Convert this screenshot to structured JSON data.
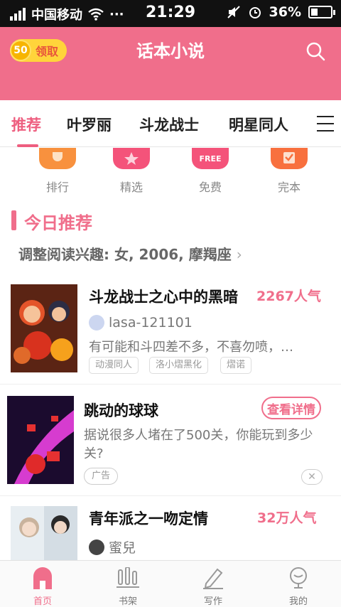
{
  "status_bar": {
    "carrier": "中国移动",
    "time": "21:29",
    "battery": "36%",
    "battery_level": 0.36
  },
  "header": {
    "coin_count": "50",
    "coin_action": "领取",
    "title": "话本小说"
  },
  "tabs": [
    {
      "label": "推荐",
      "active": true
    },
    {
      "label": "叶罗丽",
      "active": false
    },
    {
      "label": "斗龙战士",
      "active": false
    },
    {
      "label": "明星同人",
      "active": false
    }
  ],
  "categories": [
    {
      "label": "排行",
      "icon": "trophy-icon",
      "color": "#f8913e"
    },
    {
      "label": "精选",
      "icon": "star-icon",
      "color": "#f4537a"
    },
    {
      "label": "免费",
      "icon": "free-icon",
      "icon_text": "FREE",
      "color": "#f4537a"
    },
    {
      "label": "完本",
      "icon": "check-icon",
      "color": "#f8703e"
    }
  ],
  "today": {
    "title": "今日推荐",
    "interest": "调整阅读兴趣: 女, 2006, 摩羯座",
    "interest_chevron": "›"
  },
  "books": [
    {
      "title": "斗龙战士之心中的黑暗",
      "popularity": "2267人气",
      "author": "lasa-121101",
      "description": "有可能和斗四差不多，不喜勿喷，…",
      "tags": [
        "动漫同人",
        "洛小熠黑化",
        "熠诺"
      ]
    },
    {
      "title": "青年派之一吻定情",
      "popularity": "32万人气",
      "author": "蜜兒"
    }
  ],
  "ad": {
    "title": "跳动的球球",
    "detail_button": "查看详情",
    "description": "据说很多人堵在了500关，你能玩到多少关?",
    "tag": "广告",
    "close": "✕"
  },
  "bottom_nav": [
    {
      "label": "首页",
      "icon": "home-icon",
      "active": true
    },
    {
      "label": "书架",
      "icon": "bookshelf-icon",
      "active": false
    },
    {
      "label": "写作",
      "icon": "pen-icon",
      "active": false
    },
    {
      "label": "我的",
      "icon": "profile-icon",
      "active": false
    }
  ],
  "colors": {
    "brand": "#f06e8b",
    "coin": "#ffd43b"
  }
}
